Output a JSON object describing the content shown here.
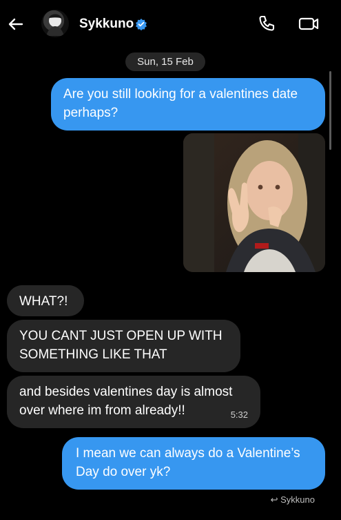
{
  "header": {
    "contact_name": "Sykkuno",
    "verified": true,
    "icons": [
      "back-arrow-icon",
      "phone-icon",
      "video-call-icon",
      "verified-badge-icon"
    ]
  },
  "conversation": {
    "date_separator": "Sun, 15 Feb",
    "messages": [
      {
        "direction": "outgoing",
        "text": "Are you still looking for a valentines date perhaps?"
      },
      {
        "direction": "outgoing",
        "type": "gif"
      },
      {
        "direction": "incoming",
        "text": "WHAT?!"
      },
      {
        "direction": "incoming",
        "text": "YOU CANT JUST OPEN UP WITH SOMETHING LIKE THAT"
      },
      {
        "direction": "incoming",
        "text": "and besides valentines day is almost over where im from already!!",
        "time": "5:32"
      },
      {
        "direction": "outgoing",
        "text": "I mean we can always do a Valentine’s Day do over yk?"
      }
    ],
    "reply_label": "Sykkuno"
  },
  "colors": {
    "background": "#000000",
    "outgoing_bubble": "#3797f0",
    "incoming_bubble": "#262626",
    "verified_badge": "#3897f0"
  }
}
